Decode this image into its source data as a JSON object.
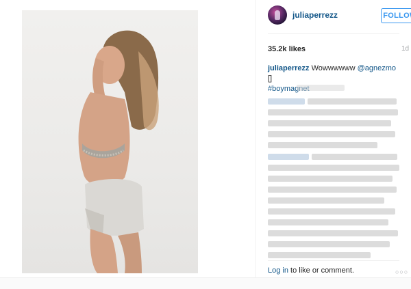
{
  "post": {
    "username": "juliaperrezz",
    "follow_label": "FOLLOW",
    "likes": "35.2k likes",
    "age": "1d",
    "caption_user": "juliaperrezz",
    "caption_text": " Wowwwwww ",
    "caption_mention": "@agnezmo",
    "caption_emoji": " []",
    "caption_hashtag": "#boymagnet",
    "login_link": "Log in",
    "login_rest": " to like or comment.",
    "more_glyph": "○○○"
  },
  "colors": {
    "link": "#125688",
    "follow_accent": "#3897f0",
    "muted": "#a5a7aa"
  },
  "icons": {
    "avatar": "avatar-image",
    "more": "more-options-icon"
  }
}
